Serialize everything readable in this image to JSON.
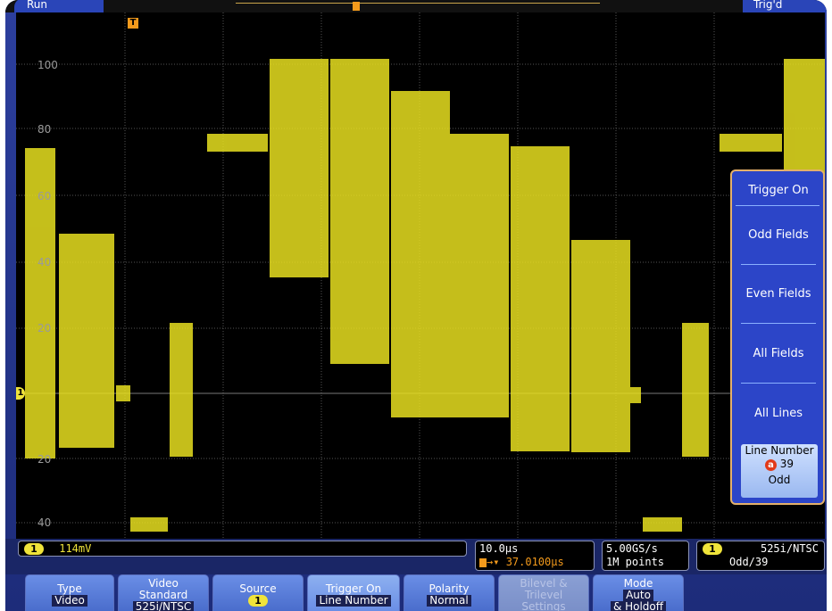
{
  "status": {
    "acquisition": "Run",
    "trigger": "Trig'd"
  },
  "markers": {
    "trigger_position": "T",
    "channel_ground": "1"
  },
  "graticule": {
    "labels": [
      "100",
      "80",
      "60",
      "40",
      "20",
      "20",
      "40"
    ]
  },
  "readouts": {
    "channel": {
      "badge": "1",
      "scale": "114mV"
    },
    "timebase": {
      "scale": "10.0µs",
      "position": "37.0100µs"
    },
    "acquisition": {
      "sample_rate": "5.00GS/s",
      "record_length": "1M points"
    },
    "trigger": {
      "badge": "1",
      "standard": "525i/NTSC",
      "field_line": "Odd/39"
    }
  },
  "softkeys": [
    {
      "name": "type",
      "l1": "Type",
      "l2": "Video"
    },
    {
      "name": "video-standard",
      "l1": "Video",
      "l1b": "Standard",
      "l2": "525i/NTSC"
    },
    {
      "name": "source",
      "l1": "Source",
      "l2": "1"
    },
    {
      "name": "trigger-on",
      "l1": "Trigger On",
      "l2": "Line Number"
    },
    {
      "name": "polarity",
      "l1": "Polarity",
      "l2": "Normal"
    },
    {
      "name": "bilevel-trilevel-settings",
      "l1": "Bilevel &",
      "l1b": "Trilevel",
      "l2": "Settings"
    },
    {
      "name": "mode",
      "l1": "Mode",
      "l2": "Auto",
      "l3": "& Holdoff"
    }
  ],
  "side_menu": {
    "title": "Trigger On",
    "items": [
      "Odd Fields",
      "Even Fields",
      "All Fields",
      "All Lines"
    ],
    "line_number": {
      "label": "Line Number",
      "cursor": "a",
      "value": "39",
      "field": "Odd"
    }
  },
  "colors": {
    "trace": "#e8e020",
    "bezel": "#1d2c7a",
    "menu": "#2c45c8"
  }
}
